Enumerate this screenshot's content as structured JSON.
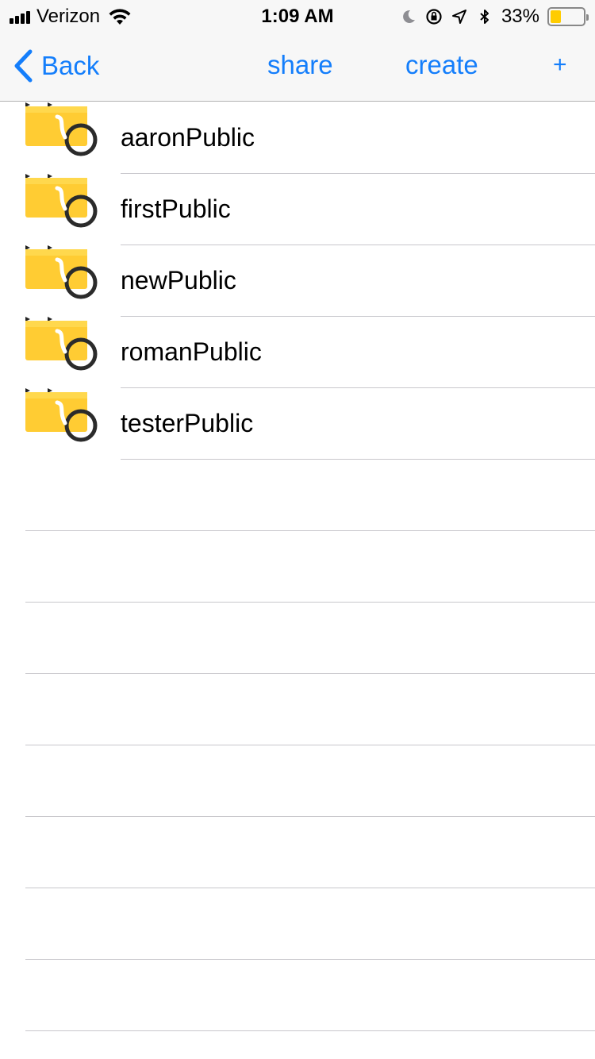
{
  "status_bar": {
    "carrier": "Verizon",
    "time": "1:09 AM",
    "battery_percent": "33%",
    "battery_level": 0.33,
    "icons": [
      "signal-icon",
      "wifi-icon",
      "moon-icon",
      "rotation-lock-icon",
      "location-icon",
      "bluetooth-icon",
      "battery-icon"
    ]
  },
  "nav": {
    "back_label": "Back",
    "share_label": "share",
    "create_label": "create",
    "add_label": "+"
  },
  "folders": [
    {
      "name": "aaronPublic",
      "icon": "shared-folder-icon"
    },
    {
      "name": "firstPublic",
      "icon": "shared-folder-icon"
    },
    {
      "name": "newPublic",
      "icon": "shared-folder-icon"
    },
    {
      "name": "romanPublic",
      "icon": "shared-folder-icon"
    },
    {
      "name": "testerPublic",
      "icon": "shared-folder-icon"
    }
  ],
  "colors": {
    "accent": "#147efb",
    "folder": "#ffcc33",
    "separator": "#c8c7cc",
    "bar_background": "#f7f7f7"
  }
}
